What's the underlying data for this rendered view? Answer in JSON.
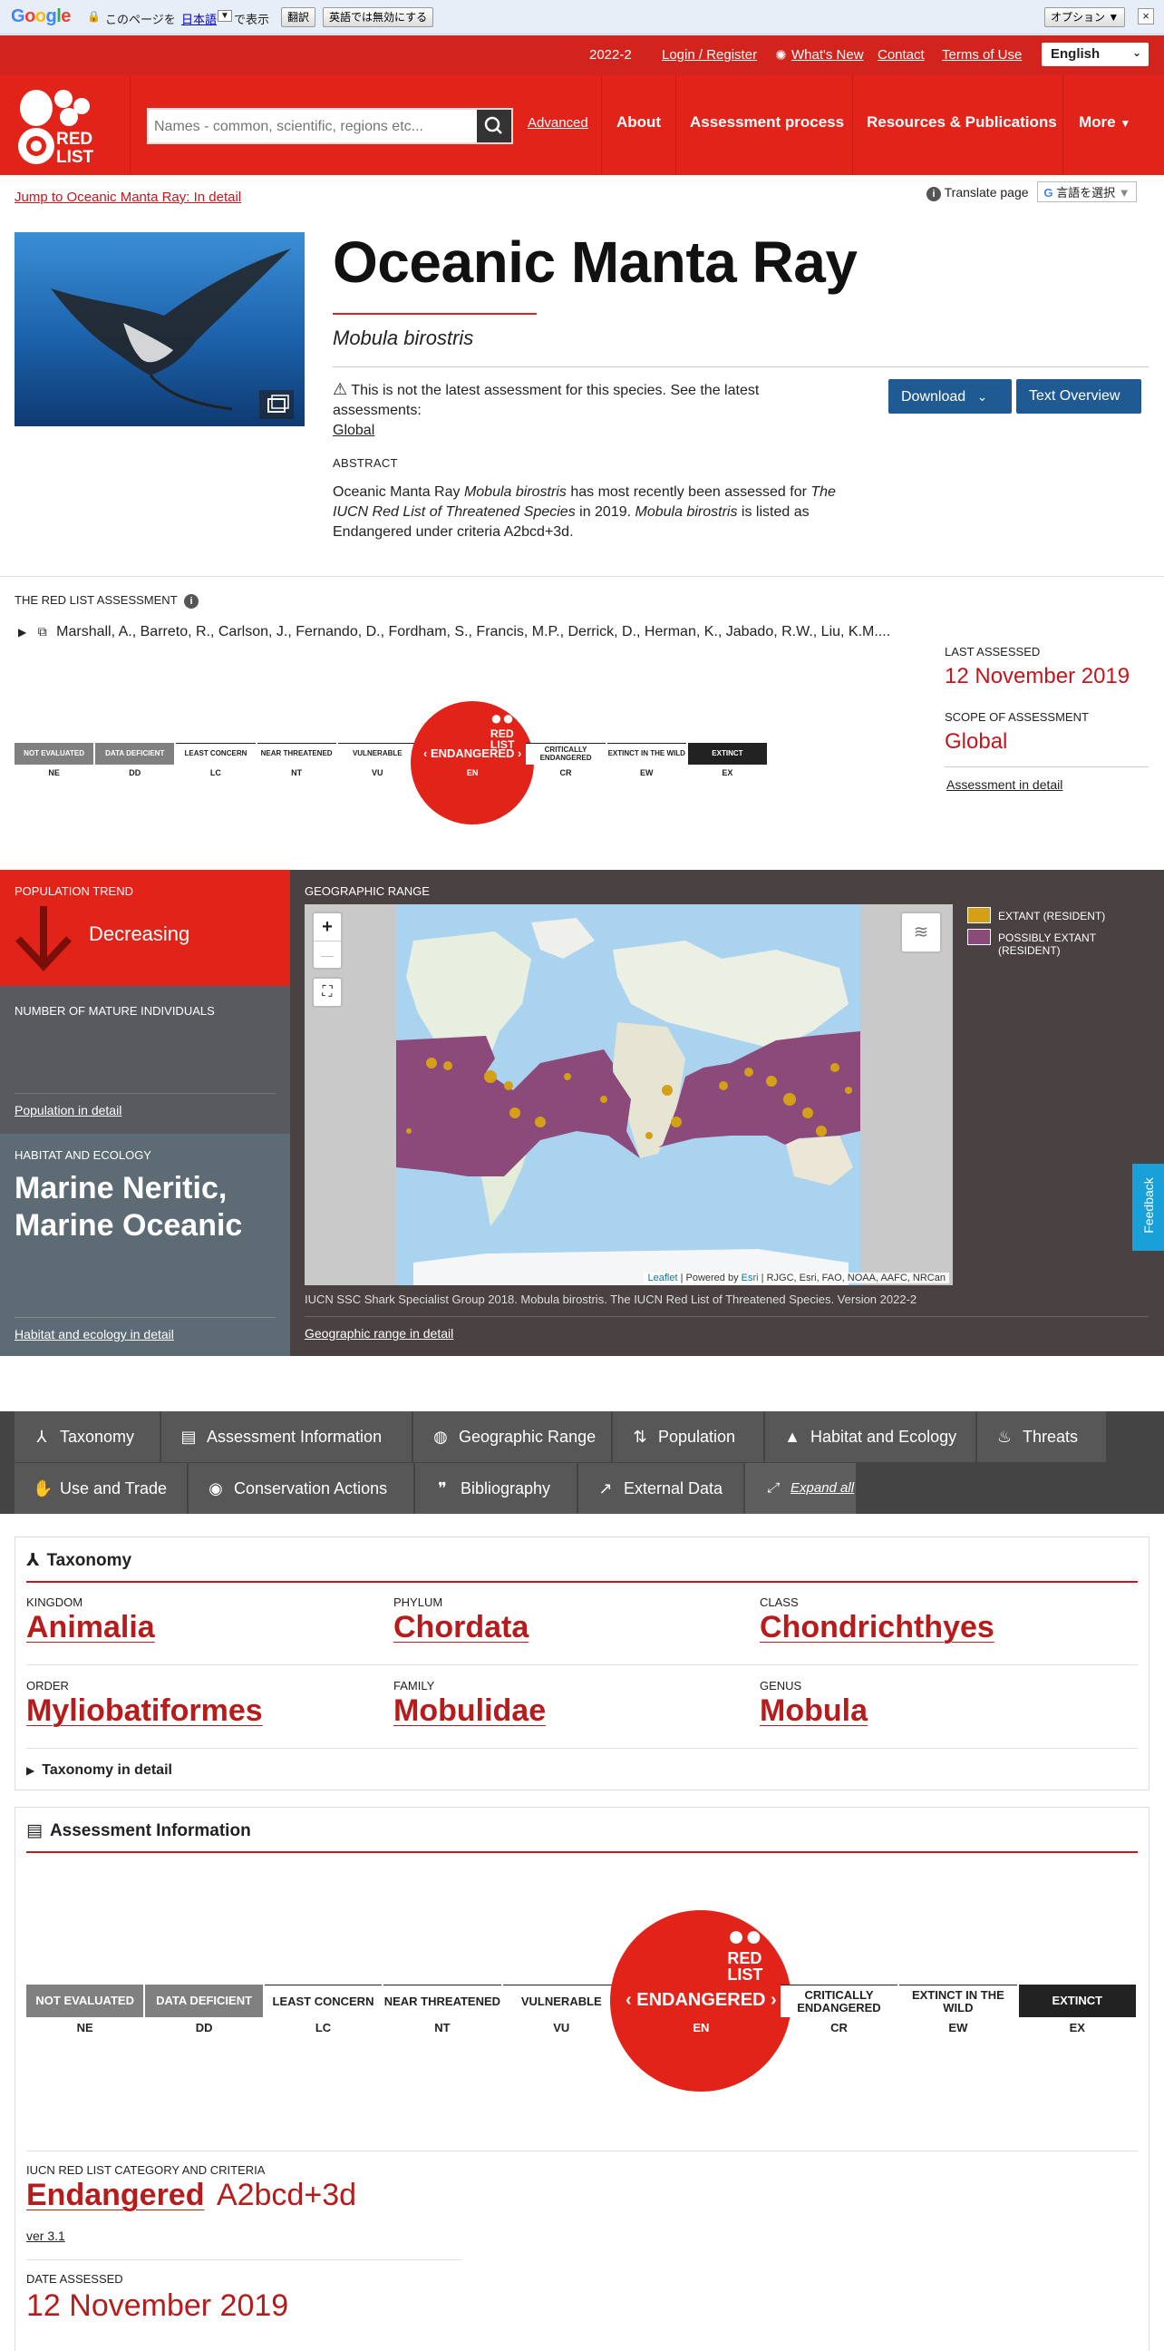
{
  "translate_bar": {
    "logo": "Google",
    "text1": "このページを",
    "lang_link": "日本語",
    "text2": "で表示",
    "translate_btn": "翻訳",
    "disable_btn": "英語では無効にする",
    "options_btn": "オプション ▼",
    "close": "×"
  },
  "util_bar": {
    "version": "2022-2",
    "login": "Login / Register",
    "whats_new": "What's New",
    "contact": "Contact",
    "terms": "Terms of Use",
    "language": "English"
  },
  "nav": {
    "logo_text": "RED LIST",
    "search_placeholder": "Names - common, scientific, regions etc...",
    "advanced": "Advanced",
    "items": [
      "About",
      "Assessment process",
      "Resources & Publications",
      "More"
    ]
  },
  "page": {
    "jump_link": "Jump to Oceanic Manta Ray: In detail",
    "translate_label": "Translate page",
    "translate_select": "言語を選択",
    "title": "Oceanic Manta Ray",
    "scientific_name": "Mobula birostris",
    "notice": "This is not the latest assessment for this species. See the latest assessments:",
    "notice_link": "Global",
    "download": "Download",
    "text_overview": "Text Overview",
    "abstract_label": "ABSTRACT",
    "abstract": {
      "p1": "Oceanic Manta Ray ",
      "sci1": "Mobula birostris",
      "p2": " has most recently been assessed for ",
      "pub": "The IUCN Red List of Threatened Species",
      "p3": " in 2019. ",
      "sci2": "Mobula birostris",
      "p4": " is listed as Endangered under criteria A2bcd+3d."
    }
  },
  "assessment": {
    "label": "THE RED LIST ASSESSMENT",
    "assessors": "Marshall, A., Barreto, R., Carlson, J., Fernando, D., Fordham, S., Francis, M.P., Derrick, D., Herman, K., Jabado, R.W., Liu, K.M....",
    "last_assessed_label": "LAST ASSESSED",
    "last_assessed": "12 November 2019",
    "scope_label": "SCOPE OF ASSESSMENT",
    "scope": "Global",
    "detail_link": "Assessment in detail",
    "categories": [
      {
        "name": "Not Evaluated",
        "abbr": "NE",
        "bg": "#808080",
        "fg": "#ffffff"
      },
      {
        "name": "Data Deficient",
        "abbr": "DD",
        "bg": "#808080",
        "fg": "#ffffff"
      },
      {
        "name": "Least Concern",
        "abbr": "LC",
        "bg": "#ffffff",
        "fg": "#222222"
      },
      {
        "name": "Near Threatened",
        "abbr": "NT",
        "bg": "#ffffff",
        "fg": "#222222"
      },
      {
        "name": "Vulnerable",
        "abbr": "VU",
        "bg": "#ffffff",
        "fg": "#222222"
      },
      {
        "name": "Endangered",
        "abbr": "EN",
        "bg": "#e2231a",
        "fg": "#ffffff"
      },
      {
        "name": "Critically Endangered",
        "abbr": "CR",
        "bg": "#ffffff",
        "fg": "#222222"
      },
      {
        "name": "Extinct in the Wild",
        "abbr": "EW",
        "bg": "#ffffff",
        "fg": "#222222"
      },
      {
        "name": "Extinct",
        "abbr": "EX",
        "bg": "#222222",
        "fg": "#ffffff"
      }
    ],
    "current_category": "ENDANGERED",
    "current_abbr": "EN"
  },
  "band": {
    "pop_trend_label": "POPULATION TREND",
    "pop_trend": "Decreasing",
    "mature_label": "NUMBER OF MATURE INDIVIDUALS",
    "pop_detail": "Population in detail",
    "habitat_label": "HABITAT AND ECOLOGY",
    "habitat": "Marine Neritic, Marine Oceanic",
    "habitat_detail": "Habitat and ecology in detail",
    "geo_label": "GEOGRAPHIC RANGE",
    "legend_extant": "EXTANT (RESIDENT)",
    "legend_possibly": "POSSIBLY EXTANT (RESIDENT)",
    "map_attrib_leaflet": "Leaflet",
    "map_attrib_rest1": " | Powered by ",
    "map_attrib_esri": "Esri",
    "map_attrib_rest2": " | RJGC, Esri, FAO, NOAA, AAFC, NRCan",
    "map_credit": "IUCN SSC Shark Specialist Group 2018. Mobula birostris. The IUCN Red List of Threatened Species. Version 2022-2",
    "geo_detail": "Geographic range in detail",
    "feedback": "Feedback",
    "zoom_in": "+",
    "zoom_out": "—",
    "colors": {
      "extant": "#d4a017",
      "possibly": "#8c4a7a"
    }
  },
  "tabs": [
    {
      "label": "Taxonomy",
      "icon": "taxonomy-icon",
      "glyph": "⅄"
    },
    {
      "label": "Assessment Information",
      "icon": "clipboard-icon",
      "glyph": "▤"
    },
    {
      "label": "Geographic Range",
      "icon": "globe-icon",
      "glyph": "◍"
    },
    {
      "label": "Population",
      "icon": "population-icon",
      "glyph": "⇅"
    },
    {
      "label": "Habitat and Ecology",
      "icon": "mountain-icon",
      "glyph": "▲"
    },
    {
      "label": "Threats",
      "icon": "flame-icon",
      "glyph": "♨"
    },
    {
      "label": "Use and Trade",
      "icon": "hand-icon",
      "glyph": "✋"
    },
    {
      "label": "Conservation Actions",
      "icon": "eye-icon",
      "glyph": "◉"
    },
    {
      "label": "Bibliography",
      "icon": "quote-icon",
      "glyph": "❞"
    },
    {
      "label": "External Data",
      "icon": "external-link-icon",
      "glyph": "↗"
    },
    {
      "label": "Expand all",
      "icon": "expand-icon",
      "glyph": "⤢"
    }
  ],
  "taxonomy": {
    "title": "Taxonomy",
    "kingdom_label": "KINGDOM",
    "kingdom": "Animalia",
    "phylum_label": "PHYLUM",
    "phylum": "Chordata",
    "class_label": "CLASS",
    "class": "Chondrichthyes",
    "order_label": "ORDER",
    "order": "Myliobatiformes",
    "family_label": "FAMILY",
    "family": "Mobulidae",
    "genus_label": "GENUS",
    "genus": "Mobula",
    "detail": "Taxonomy in detail"
  },
  "assessment_info": {
    "title": "Assessment Information",
    "category_label": "IUCN RED LIST CATEGORY AND CRITERIA",
    "category": "Endangered",
    "criteria": "A2bcd+3d",
    "version": "ver 3.1",
    "date_label": "DATE ASSESSED",
    "date": "12 November 2019"
  }
}
